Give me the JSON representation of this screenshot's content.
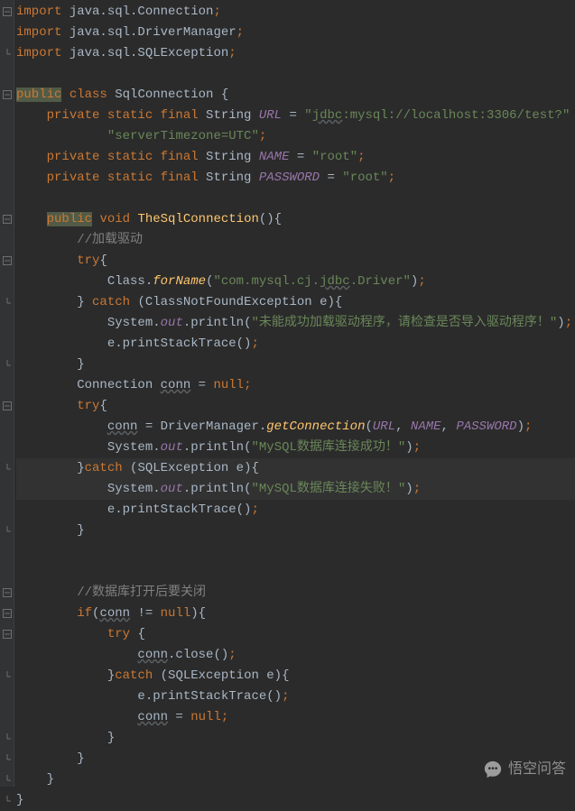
{
  "lines": [
    {
      "indent": 0,
      "tokens": [
        {
          "t": "import",
          "c": "kw"
        },
        {
          "t": " java.sql.Connection",
          "c": "plain"
        },
        {
          "t": ";",
          "c": "semi"
        }
      ]
    },
    {
      "indent": 0,
      "tokens": [
        {
          "t": "import",
          "c": "kw"
        },
        {
          "t": " java.sql.DriverManager",
          "c": "plain"
        },
        {
          "t": ";",
          "c": "semi"
        }
      ]
    },
    {
      "indent": 0,
      "tokens": [
        {
          "t": "import",
          "c": "kw"
        },
        {
          "t": " java.sql.SQLException",
          "c": "plain"
        },
        {
          "t": ";",
          "c": "semi"
        }
      ]
    },
    {
      "indent": 0,
      "tokens": []
    },
    {
      "indent": 0,
      "tokens": [
        {
          "t": "public",
          "c": "kw-hl"
        },
        {
          "t": " ",
          "c": "plain"
        },
        {
          "t": "class",
          "c": "kw"
        },
        {
          "t": " SqlConnection {",
          "c": "plain"
        }
      ]
    },
    {
      "indent": 1,
      "tokens": [
        {
          "t": "private static final",
          "c": "kw"
        },
        {
          "t": " String ",
          "c": "plain"
        },
        {
          "t": "URL",
          "c": "static-field"
        },
        {
          "t": " = ",
          "c": "plain"
        },
        {
          "t": "\"",
          "c": "str"
        },
        {
          "t": "jdbc",
          "c": "str underline"
        },
        {
          "t": ":mysql://localhost:3306/test?\"",
          "c": "str"
        },
        {
          "t": " +",
          "c": "plain"
        }
      ]
    },
    {
      "indent": 3,
      "tokens": [
        {
          "t": "\"serverTimezone=UTC\"",
          "c": "str"
        },
        {
          "t": ";",
          "c": "semi"
        }
      ]
    },
    {
      "indent": 1,
      "tokens": [
        {
          "t": "private static final",
          "c": "kw"
        },
        {
          "t": " String ",
          "c": "plain"
        },
        {
          "t": "NAME",
          "c": "static-field"
        },
        {
          "t": " = ",
          "c": "plain"
        },
        {
          "t": "\"root\"",
          "c": "str"
        },
        {
          "t": ";",
          "c": "semi"
        }
      ]
    },
    {
      "indent": 1,
      "tokens": [
        {
          "t": "private static final",
          "c": "kw"
        },
        {
          "t": " String ",
          "c": "plain"
        },
        {
          "t": "PASSWORD",
          "c": "static-field"
        },
        {
          "t": " = ",
          "c": "plain"
        },
        {
          "t": "\"root\"",
          "c": "str"
        },
        {
          "t": ";",
          "c": "semi"
        }
      ]
    },
    {
      "indent": 0,
      "tokens": []
    },
    {
      "indent": 1,
      "tokens": [
        {
          "t": "public",
          "c": "kw-hl"
        },
        {
          "t": " ",
          "c": "plain"
        },
        {
          "t": "void",
          "c": "kw"
        },
        {
          "t": " ",
          "c": "plain"
        },
        {
          "t": "TheSqlConnection",
          "c": "method"
        },
        {
          "t": "(){",
          "c": "plain"
        }
      ]
    },
    {
      "indent": 2,
      "tokens": [
        {
          "t": "//加载驱动",
          "c": "comment"
        }
      ]
    },
    {
      "indent": 2,
      "tokens": [
        {
          "t": "try",
          "c": "kw"
        },
        {
          "t": "{",
          "c": "plain"
        }
      ]
    },
    {
      "indent": 3,
      "tokens": [
        {
          "t": "Class.",
          "c": "plain"
        },
        {
          "t": "forName",
          "c": "method-i"
        },
        {
          "t": "(",
          "c": "plain"
        },
        {
          "t": "\"com.mysql.cj.",
          "c": "str"
        },
        {
          "t": "jdbc",
          "c": "str underline"
        },
        {
          "t": ".Driver\"",
          "c": "str"
        },
        {
          "t": ")",
          "c": "plain"
        },
        {
          "t": ";",
          "c": "semi"
        }
      ]
    },
    {
      "indent": 2,
      "tokens": [
        {
          "t": "} ",
          "c": "plain"
        },
        {
          "t": "catch",
          "c": "kw"
        },
        {
          "t": " (ClassNotFoundException e){",
          "c": "plain"
        }
      ]
    },
    {
      "indent": 3,
      "tokens": [
        {
          "t": "System.",
          "c": "plain"
        },
        {
          "t": "out",
          "c": "static-field"
        },
        {
          "t": ".println(",
          "c": "plain"
        },
        {
          "t": "\"未能成功加载驱动程序，请检查是否导入驱动程序！\"",
          "c": "str"
        },
        {
          "t": ")",
          "c": "plain"
        },
        {
          "t": ";",
          "c": "semi"
        }
      ]
    },
    {
      "indent": 3,
      "tokens": [
        {
          "t": "e.printStackTrace()",
          "c": "plain"
        },
        {
          "t": ";",
          "c": "semi"
        }
      ]
    },
    {
      "indent": 2,
      "tokens": [
        {
          "t": "}",
          "c": "plain"
        }
      ]
    },
    {
      "indent": 2,
      "tokens": [
        {
          "t": "Connection ",
          "c": "plain"
        },
        {
          "t": "conn",
          "c": "plain underline"
        },
        {
          "t": " = ",
          "c": "plain"
        },
        {
          "t": "null",
          "c": "kw"
        },
        {
          "t": ";",
          "c": "semi"
        }
      ]
    },
    {
      "indent": 2,
      "tokens": [
        {
          "t": "try",
          "c": "kw"
        },
        {
          "t": "{",
          "c": "plain"
        }
      ]
    },
    {
      "indent": 3,
      "tokens": [
        {
          "t": "conn",
          "c": "plain underline"
        },
        {
          "t": " = DriverManager.",
          "c": "plain"
        },
        {
          "t": "getConnection",
          "c": "method-i"
        },
        {
          "t": "(",
          "c": "plain"
        },
        {
          "t": "URL",
          "c": "static-field"
        },
        {
          "t": ", ",
          "c": "plain"
        },
        {
          "t": "NAME",
          "c": "static-field"
        },
        {
          "t": ", ",
          "c": "plain"
        },
        {
          "t": "PASSWORD",
          "c": "static-field"
        },
        {
          "t": ")",
          "c": "plain"
        },
        {
          "t": ";",
          "c": "semi"
        }
      ]
    },
    {
      "indent": 3,
      "tokens": [
        {
          "t": "System.",
          "c": "plain"
        },
        {
          "t": "out",
          "c": "static-field"
        },
        {
          "t": ".println(",
          "c": "plain"
        },
        {
          "t": "\"MySQL数据库连接成功！\"",
          "c": "str"
        },
        {
          "t": ")",
          "c": "plain"
        },
        {
          "t": ";",
          "c": "semi"
        }
      ]
    },
    {
      "indent": 2,
      "hl": true,
      "tokens": [
        {
          "t": "}",
          "c": "plain"
        },
        {
          "t": "catch",
          "c": "kw"
        },
        {
          "t": " (SQLException e){",
          "c": "plain"
        }
      ]
    },
    {
      "indent": 3,
      "hl": true,
      "tokens": [
        {
          "t": "System.",
          "c": "plain"
        },
        {
          "t": "out",
          "c": "static-field"
        },
        {
          "t": ".println(",
          "c": "plain"
        },
        {
          "t": "\"MySQL数据库连接失败！\"",
          "c": "str"
        },
        {
          "t": ")",
          "c": "plain"
        },
        {
          "t": ";",
          "c": "semi"
        }
      ]
    },
    {
      "indent": 3,
      "tokens": [
        {
          "t": "e.printStackTrace()",
          "c": "plain"
        },
        {
          "t": ";",
          "c": "semi"
        }
      ]
    },
    {
      "indent": 2,
      "tokens": [
        {
          "t": "}",
          "c": "plain"
        }
      ]
    },
    {
      "indent": 0,
      "tokens": []
    },
    {
      "indent": 0,
      "tokens": []
    },
    {
      "indent": 2,
      "tokens": [
        {
          "t": "//数据库打开后要关闭",
          "c": "comment"
        }
      ]
    },
    {
      "indent": 2,
      "tokens": [
        {
          "t": "if",
          "c": "kw"
        },
        {
          "t": "(",
          "c": "plain"
        },
        {
          "t": "conn",
          "c": "plain underline"
        },
        {
          "t": " != ",
          "c": "plain"
        },
        {
          "t": "null",
          "c": "kw"
        },
        {
          "t": "){",
          "c": "plain"
        }
      ]
    },
    {
      "indent": 3,
      "tokens": [
        {
          "t": "try",
          "c": "kw"
        },
        {
          "t": " {",
          "c": "plain"
        }
      ]
    },
    {
      "indent": 4,
      "tokens": [
        {
          "t": "conn",
          "c": "plain underline"
        },
        {
          "t": ".close()",
          "c": "plain"
        },
        {
          "t": ";",
          "c": "semi"
        }
      ]
    },
    {
      "indent": 3,
      "tokens": [
        {
          "t": "}",
          "c": "plain"
        },
        {
          "t": "catch",
          "c": "kw"
        },
        {
          "t": " (SQLException e){",
          "c": "plain"
        }
      ]
    },
    {
      "indent": 4,
      "tokens": [
        {
          "t": "e.printStackTrace()",
          "c": "plain"
        },
        {
          "t": ";",
          "c": "semi"
        }
      ]
    },
    {
      "indent": 4,
      "tokens": [
        {
          "t": "conn",
          "c": "plain underline"
        },
        {
          "t": " = ",
          "c": "plain"
        },
        {
          "t": "null",
          "c": "kw"
        },
        {
          "t": ";",
          "c": "semi"
        }
      ]
    },
    {
      "indent": 3,
      "tokens": [
        {
          "t": "}",
          "c": "plain"
        }
      ]
    },
    {
      "indent": 2,
      "tokens": [
        {
          "t": "}",
          "c": "plain"
        }
      ]
    },
    {
      "indent": 1,
      "tokens": [
        {
          "t": "}",
          "c": "plain"
        }
      ]
    },
    {
      "indent": 0,
      "tokens": [
        {
          "t": "}",
          "c": "plain"
        }
      ]
    }
  ],
  "gutterIcons": [
    {
      "line": 0,
      "type": "minus"
    },
    {
      "line": 2,
      "type": "up"
    },
    {
      "line": 4,
      "type": "minus"
    },
    {
      "line": 10,
      "type": "minus"
    },
    {
      "line": 12,
      "type": "minus"
    },
    {
      "line": 14,
      "type": "up"
    },
    {
      "line": 17,
      "type": "up"
    },
    {
      "line": 19,
      "type": "minus"
    },
    {
      "line": 22,
      "type": "up"
    },
    {
      "line": 25,
      "type": "up"
    },
    {
      "line": 28,
      "type": "minus"
    },
    {
      "line": 29,
      "type": "minus"
    },
    {
      "line": 30,
      "type": "minus"
    },
    {
      "line": 32,
      "type": "up"
    },
    {
      "line": 35,
      "type": "up"
    },
    {
      "line": 36,
      "type": "up"
    },
    {
      "line": 37,
      "type": "up"
    },
    {
      "line": 38,
      "type": "up"
    }
  ],
  "watermark": "悟空问答"
}
